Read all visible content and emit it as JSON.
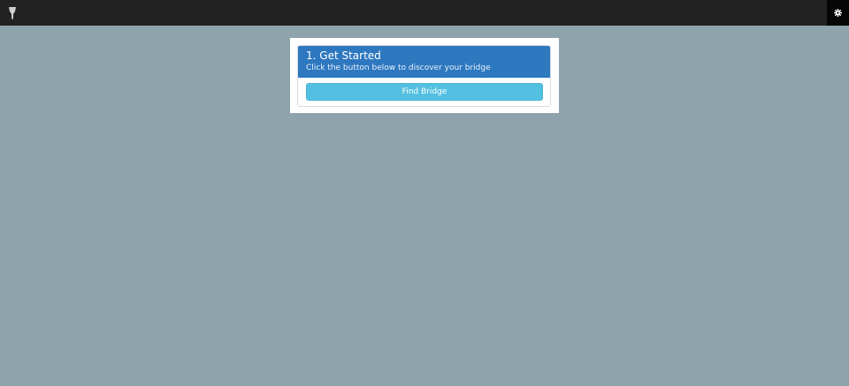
{
  "topbar": {
    "logo_icon": "light-bulb-icon",
    "settings_icon": "gear-icon"
  },
  "panel": {
    "title": "1. Get Started",
    "subtitle": "Click the button below to discover your bridge",
    "button_label": "Find Bridge"
  },
  "colors": {
    "background": "#8fa3ad",
    "topbar": "#222222",
    "header": "#2e78c0",
    "button": "#54c0e1"
  }
}
